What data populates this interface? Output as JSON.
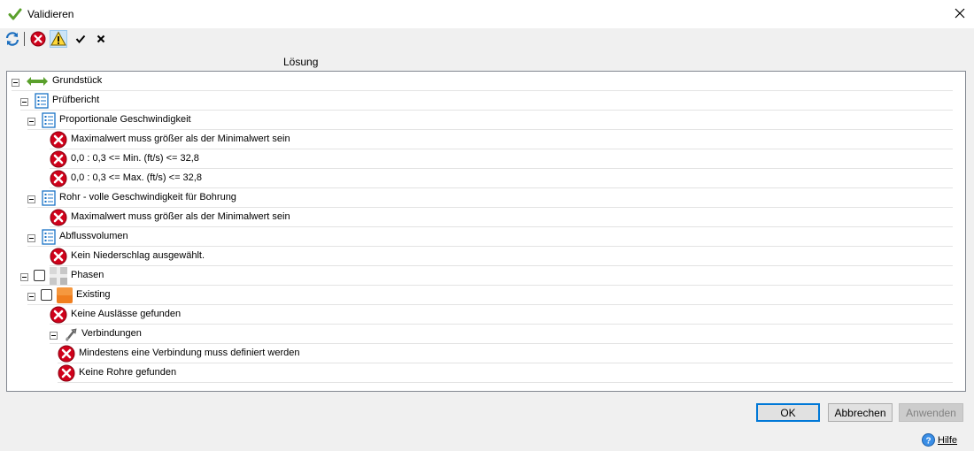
{
  "window": {
    "title": "Validieren",
    "title_icon": "green-checkmark-icon",
    "close_icon": "close-icon"
  },
  "toolbar": {
    "items": [
      {
        "name": "refresh-button",
        "icon": "refresh-icon"
      },
      {
        "name": "show-errors-button",
        "icon": "error-icon"
      },
      {
        "name": "show-warnings-button",
        "icon": "warning-icon"
      },
      {
        "name": "check-all-button",
        "icon": "check-icon"
      },
      {
        "name": "uncheck-all-button",
        "icon": "x-icon"
      }
    ]
  },
  "column_header": "Lösung",
  "tree": [
    {
      "label": "Grundstück",
      "level": 0,
      "icon": "parcel-icon",
      "expander": true
    },
    {
      "label": "Prüfbericht",
      "level": 1,
      "icon": "report-icon",
      "expander": true
    },
    {
      "label": "Proportionale Geschwindigkeit",
      "level": 2,
      "icon": "report-icon",
      "expander": true
    },
    {
      "label": "Maximalwert muss größer als der Minimalwert sein",
      "level": 3,
      "icon": "error-icon"
    },
    {
      "label": "0,0 : 0,3 <= Min. (ft/s) <= 32,8",
      "level": 3,
      "icon": "error-icon"
    },
    {
      "label": "0,0 : 0,3 <= Max. (ft/s) <= 32,8",
      "level": 3,
      "icon": "error-icon"
    },
    {
      "label": "Rohr - volle Geschwindigkeit für Bohrung",
      "level": 2,
      "icon": "report-icon",
      "expander": true
    },
    {
      "label": "Maximalwert muss größer als der Minimalwert sein",
      "level": 3,
      "icon": "error-icon"
    },
    {
      "label": "Abflussvolumen",
      "level": 2,
      "icon": "report-icon",
      "expander": true
    },
    {
      "label": "Kein Niederschlag ausgewählt.",
      "level": 3,
      "icon": "error-icon"
    },
    {
      "label": "Phasen",
      "level": 1,
      "icon": "phases-icon",
      "expander": true,
      "checkbox": true
    },
    {
      "label": "Existing",
      "level": 2,
      "icon": "phase-orange-icon",
      "expander": true,
      "checkbox": true
    },
    {
      "label": "Keine Auslässe gefunden",
      "level": 3,
      "icon": "error-icon"
    },
    {
      "label": "Verbindungen",
      "level": 3,
      "icon": "pipe-connection-icon",
      "expander": true
    },
    {
      "label": "Mindestens eine Verbindung muss definiert werden",
      "level": 4,
      "icon": "error-icon"
    },
    {
      "label": "Keine Rohre gefunden",
      "level": 4,
      "icon": "error-icon"
    }
  ],
  "buttons": {
    "ok": "OK",
    "cancel": "Abbrechen",
    "apply": "Anwenden"
  },
  "help": {
    "label": "Hilfe",
    "icon": "help-icon"
  },
  "colors": {
    "error_red": "#d0021b",
    "accent_blue": "#0078d7",
    "tree_green": "#5aa02c"
  }
}
